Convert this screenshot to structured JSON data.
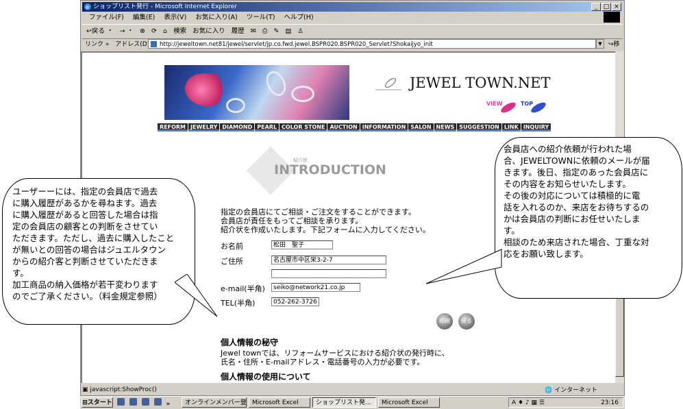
{
  "window": {
    "title": "ショップリスト発行 - Microsoft Internet Explorer",
    "min": "_",
    "max": "□",
    "close": "×"
  },
  "menu": [
    "ファイル(F)",
    "編集(E)",
    "表示(V)",
    "お気に入り(A)",
    "ツール(T)",
    "ヘルプ(H)"
  ],
  "toolbar": {
    "back": "↩戻る ・",
    "forward": "→ ・",
    "search": "検索",
    "favorites": "お気に入り",
    "history": "履歴"
  },
  "address": {
    "links": "リンク »",
    "label": "アドレス(D)",
    "url": "http://jeweltown.net81/jewel/servlet/jp.co.fwd.jewel.BSPR020.BSPR020_Servlet?Shokaijyo_init",
    "go": "移動"
  },
  "site": {
    "brand": "JEWEL TOWN.NET",
    "view_label": "VIEW",
    "top_label": "TOP",
    "nav": [
      "REFORM",
      "JEWELRY",
      "DIAMOND",
      "PEARL",
      "COLOR STONE",
      "AUCTION",
      "INFORMATION",
      "SALON",
      "NEWS",
      "SUGGESTION",
      "LINK",
      "INQUIRY"
    ],
    "intro_small": "紹介状",
    "intro_title": "INTRODUCTION"
  },
  "form": {
    "intro_lines": [
      "指定の会員店にてご相談・ご注文をすることができます。",
      "会員店が責任をもってご相談を承ります。",
      "紹介状を作成いたします。下記フォームに入力してください。"
    ],
    "name_label": "お名前",
    "name_value": "松田　聖子",
    "address_label": "ご住所",
    "address_value": "名古屋市中区栄3-2-7",
    "address2_value": "",
    "email_label": "e-mail(半角)",
    "email_value": "seiko@network21.co.jp",
    "tel_label": "TEL(半角)",
    "tel_value": "052-262-3726",
    "print_button": "印刷",
    "back_button": "戻る"
  },
  "privacy": {
    "secret_title": "個人情報の秘守",
    "secret_text_1": "Jewel townでは、リフォームサービスにおける紹介状の発行時に、",
    "secret_text_2": "氏名・住所・E-mailアドレス・電話番号の入力が必要です。",
    "use_title": "個人情報の使用について"
  },
  "callout_left": [
    "ユーザーーには、指定の会員店で過去",
    "に購入履歴があるかを尋ねます。過去",
    "に購入履歴があると回答した場合は指",
    "定の会員店の顧客との判断をさせてい",
    "ただきます。ただし、過去に購入したこと",
    "が無いとの回答の場合はジュエルタウン",
    "からの紹介客と判断させていただきま",
    "す。",
    "加工商品の納入価格が若干変わります",
    "のでご了承ください。（料金規定参照）"
  ],
  "callout_right": [
    "会員店への紹介依頼が行われた場",
    "合、JEWELTOWNに依頼のメールが届",
    "きます。後日、指定のあった会員店に",
    "その内容をお知らせいたします。",
    "その後の対応については積極的に電",
    "話を入れるのか、来店をお待ちするの",
    "かは会員店の判断にお任せいたしま",
    "す。",
    "相談のため来店された場合、丁重な対",
    "応をお願い致します。"
  ],
  "status": {
    "text": "javascript:ShowProc()",
    "zone": "インターネット"
  },
  "taskbar": {
    "start": "スタート",
    "more": "»",
    "tasks": [
      "オンラインメンバー登録",
      "Microsoft Excel",
      "ショップリスト発...",
      "Microsoft Excel"
    ],
    "clock": "23:16"
  }
}
